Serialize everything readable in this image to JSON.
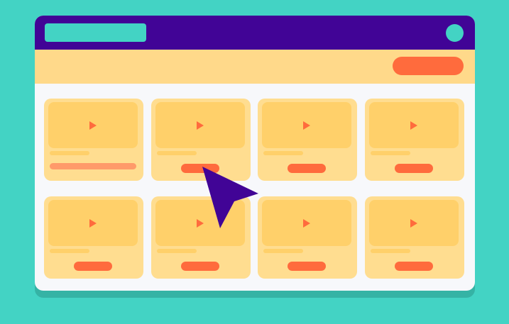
{
  "colors": {
    "background": "#43d3c4",
    "titlebar": "#410496",
    "toolbar": "#ffd98a",
    "accent": "#ff6b3d",
    "card": "#ffdd90",
    "thumbnail": "#ffd06a",
    "cursor": "#410496"
  },
  "icons": {
    "card_play": "play-icon",
    "pointer": "cursor-arrow-icon"
  },
  "cards": [
    {
      "row": 1,
      "col": 1,
      "style": "progress-bar"
    },
    {
      "row": 1,
      "col": 2,
      "style": "button"
    },
    {
      "row": 1,
      "col": 3,
      "style": "button"
    },
    {
      "row": 1,
      "col": 4,
      "style": "button"
    },
    {
      "row": 2,
      "col": 1,
      "style": "button"
    },
    {
      "row": 2,
      "col": 2,
      "style": "button"
    },
    {
      "row": 2,
      "col": 3,
      "style": "button"
    },
    {
      "row": 2,
      "col": 4,
      "style": "button"
    }
  ]
}
